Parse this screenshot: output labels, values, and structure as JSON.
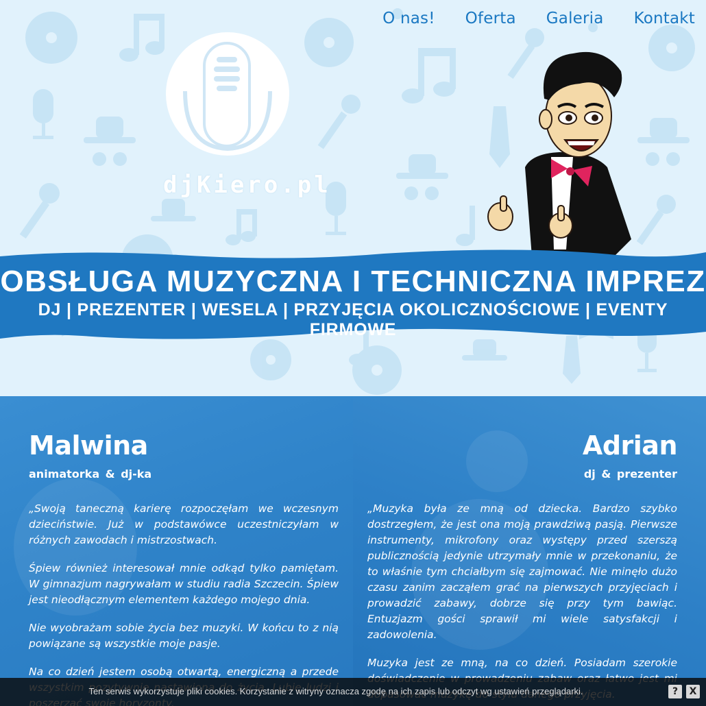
{
  "nav": {
    "items": [
      {
        "label": "O nas!"
      },
      {
        "label": "Oferta"
      },
      {
        "label": "Galeria"
      },
      {
        "label": "Kontakt"
      }
    ]
  },
  "logo": {
    "text": "djKiero.pl",
    "icon": "microphone-icon"
  },
  "banner": {
    "title": "OBSŁUGA MUZYCZNA I TECHNICZNA IMPREZ",
    "subtitle": "DJ | PREZENTER | WESELA | PRZYJĘCIA OKOLICZNOŚCIOWE | EVENTY FIRMOWE"
  },
  "team": {
    "left": {
      "name": "Malwina",
      "role": "animatorka & dj-ka",
      "paragraphs": [
        "„Swoją taneczną karierę rozpoczęłam we wczesnym dzieciństwie. Już w podstawówce uczestniczyłam w różnych zawodach i mistrzostwach.",
        "Śpiew również interesował mnie odkąd tylko pamiętam. W gimnazjum nagrywałam w studiu radia Szczecin. Śpiew jest nieodłącznym elementem każdego mojego dnia.",
        "Nie wyobrażam sobie życia bez muzyki. W końcu to z nią powiązane są wszystkie moje pasje.",
        "Na co dzień jestem osobą otwartą, energiczną a przede wszystkim pozytywnie nastawioną do życia. Lubię ludzi i poszerzać swoje horyzonty."
      ]
    },
    "right": {
      "name": "Adrian",
      "role": "dj & prezenter",
      "paragraphs": [
        "„Muzyka była ze mną od dziecka. Bardzo szybko dostrzegłem, że jest ona moją prawdziwą pasją. Pierwsze instrumenty, mikrofony oraz występy przed szerszą publicznością jedynie utrzymały mnie w przekonaniu, że to właśnie tym chciałbym się zajmować. Nie minęło dużo czasu zanim zacząłem grać na pierwszych przyjęciach i prowadzić zabawy, dobrze się przy tym bawiąc. Entuzjazm gości sprawił mi wiele satysfakcji i zadowolenia.",
        "Muzyka jest ze mną, na co dzień. Posiadam szerokie doświadczenie w prowadzeniu zabaw oraz łatwo jest mi dopasować muzykę do stylu danego przyjęcia."
      ]
    }
  },
  "cookie": {
    "text": "Ten serwis wykorzystuje pliki cookies. Korzystanie z witryny oznacza zgodę na ich zapis lub odczyt wg ustawień przeglądarki.",
    "help_label": "?",
    "close_label": "X"
  },
  "colors": {
    "accent": "#1a78c2",
    "banner": "#1f78c1",
    "hero_bg": "#e1f2fc",
    "team_bg": "#2a7fc7"
  }
}
